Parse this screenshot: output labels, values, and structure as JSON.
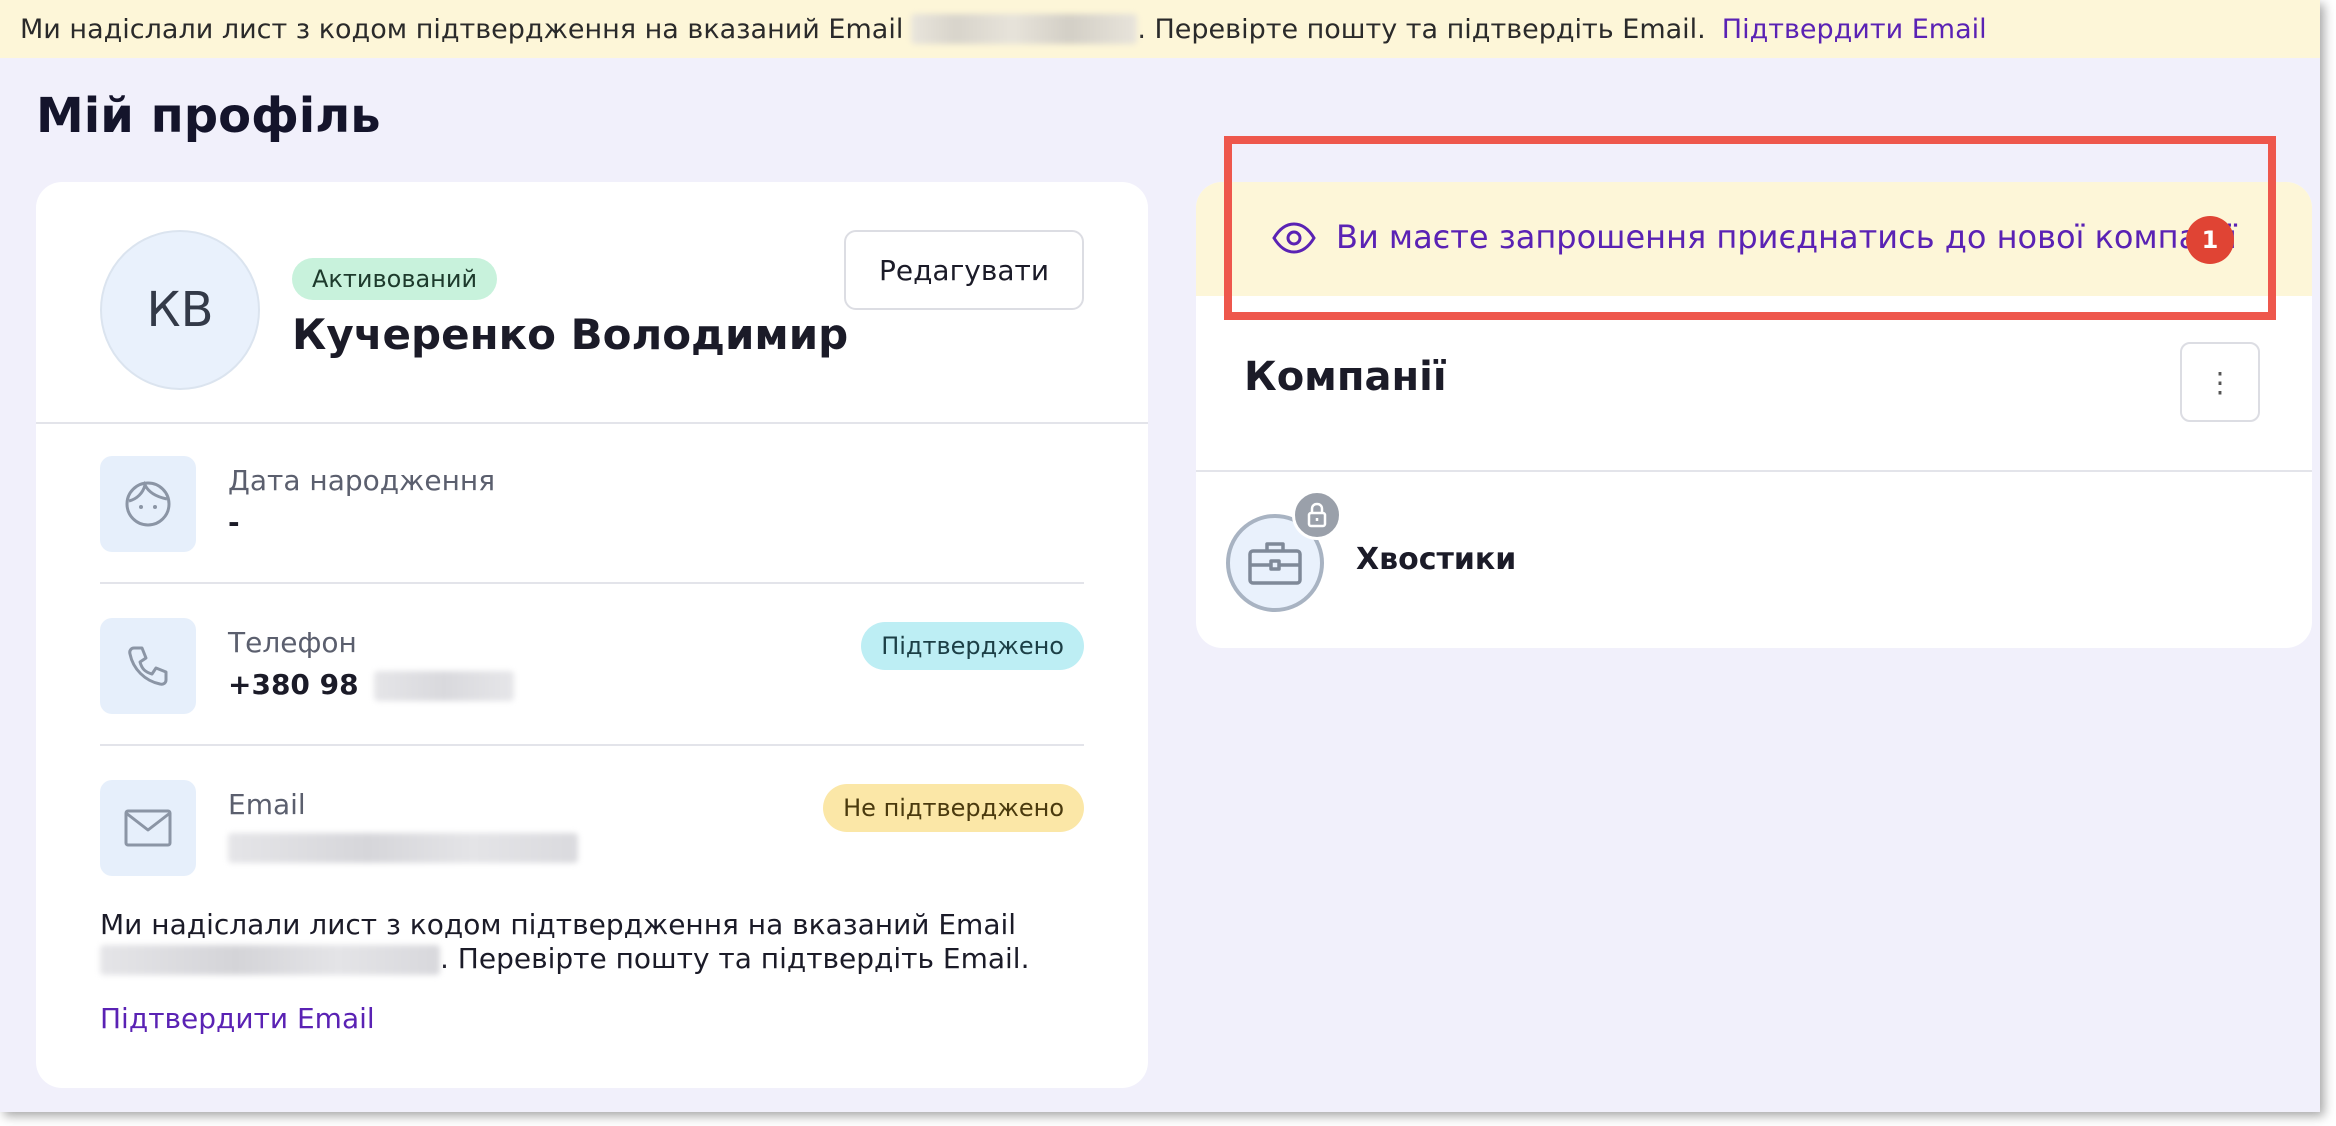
{
  "banner": {
    "text_before": "Ми надіслали лист з кодом підтвердження на вказаний Email",
    "text_after": ". Перевірте пошту та підтвердіть Email.",
    "link": "Підтвердити Email"
  },
  "page": {
    "title": "Мій профіль"
  },
  "profile": {
    "initials": "КВ",
    "status": "Активований",
    "name": "Кучеренко Володимир",
    "edit_label": "Редагувати",
    "birthdate": {
      "label": "Дата народження",
      "value": "-"
    },
    "phone": {
      "label": "Телефон",
      "value": "+380 98",
      "status": "Підтверджено"
    },
    "email": {
      "label": "Email",
      "status": "Не підтверджено"
    },
    "note_before": "Ми надіслали лист з кодом підтвердження на вказаний Email",
    "note_after": ". Перевірте пошту та підтвердіть Email.",
    "confirm_link": "Підтвердити Email"
  },
  "companies": {
    "invite_text": "Ви маєте запрошення приєднатись до нової компанії",
    "invite_count": "1",
    "title": "Компанії",
    "menu_glyph": "⋮",
    "items": [
      {
        "name": "Хвостики"
      }
    ]
  },
  "colors": {
    "accent": "#5a22b4",
    "background": "#f1f0fb",
    "banner": "#fdf6d8",
    "badge": "#e04434",
    "highlight": "#ee574c"
  },
  "icons": [
    "eye-icon",
    "face-icon",
    "phone-icon",
    "mail-icon",
    "briefcase-icon",
    "lock-icon",
    "more-vertical-icon"
  ]
}
